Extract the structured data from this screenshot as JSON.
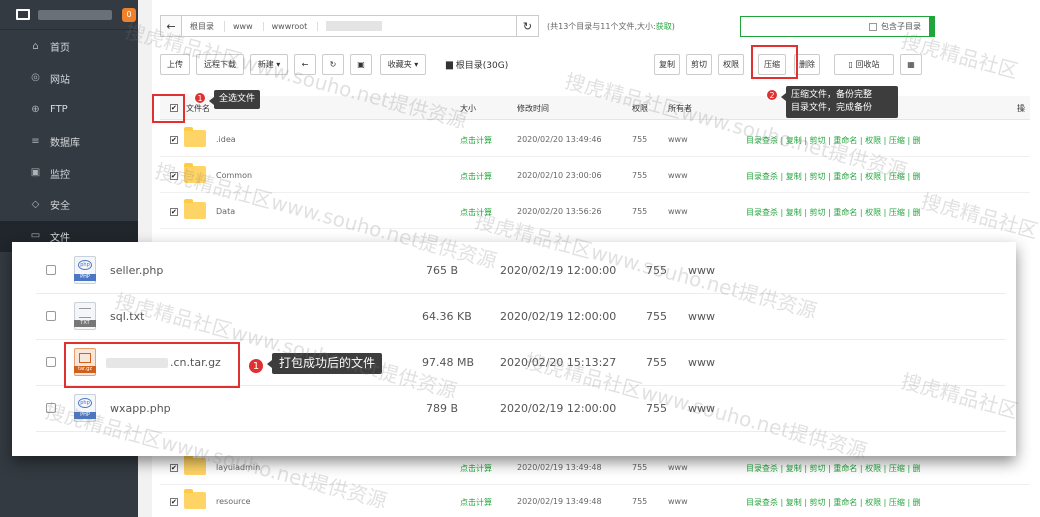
{
  "sidebar": {
    "badge": "0",
    "items": [
      {
        "label": "首页",
        "icon": "home-icon"
      },
      {
        "label": "网站",
        "icon": "globe-icon"
      },
      {
        "label": "FTP",
        "icon": "ftp-icon"
      },
      {
        "label": "数据库",
        "icon": "database-icon"
      },
      {
        "label": "监控",
        "icon": "monitor-icon"
      },
      {
        "label": "安全",
        "icon": "shield-icon"
      },
      {
        "label": "文件",
        "icon": "folder-icon"
      }
    ]
  },
  "pathbar": {
    "root": "根目录",
    "crumb1": "www",
    "crumb2": "wwwroot",
    "info_prefix": "(共13个目录与11个文件,大小:",
    "info_link": "获取",
    "info_suffix": ")",
    "subdir_label": "包含子目录"
  },
  "toolbar": {
    "upload": "上传",
    "remote_download": "远程下载",
    "new": "新建",
    "favorites": "收藏夹",
    "disk": "根目录(30G)",
    "copy": "复制",
    "cut": "剪切",
    "perm": "权限",
    "compress": "压缩",
    "delete": "删除",
    "recycle": "回收站"
  },
  "table": {
    "headers": {
      "name": "文件名",
      "size": "大小",
      "mtime": "修改时间",
      "perm": "权限",
      "owner": "所有者",
      "op": "操"
    },
    "rows": [
      {
        "name": ".idea",
        "size": "点击计算",
        "mtime": "2020/02/20 13:49:46",
        "perm": "755",
        "owner": "www"
      },
      {
        "name": "Common",
        "size": "点击计算",
        "mtime": "2020/02/10 23:00:06",
        "perm": "755",
        "owner": "www"
      },
      {
        "name": "Data",
        "size": "点击计算",
        "mtime": "2020/02/20 13:56:26",
        "perm": "755",
        "owner": "www"
      }
    ],
    "bottom_rows": [
      {
        "name": "layuiadmin",
        "size": "点击计算",
        "mtime": "2020/02/19 13:49:48",
        "perm": "755",
        "owner": "www"
      },
      {
        "name": "resource",
        "size": "点击计算",
        "mtime": "2020/02/19 13:49:48",
        "perm": "755",
        "owner": "www"
      }
    ],
    "ops": "目录查杀 | 复制 | 剪切 | 重命名 | 权限 | 压缩 | 删"
  },
  "callouts": {
    "select_all": "全选文件",
    "compress_tip_line1": "压缩文件，备份完整",
    "compress_tip_line2": "目录文件，完成备份",
    "packed_tip": "打包成功后的文件",
    "n1": "1",
    "n2": "2"
  },
  "zoom": {
    "rows": [
      {
        "name": "seller.php",
        "size": "765 B",
        "mtime": "2020/02/19 12:00:00",
        "perm": "755",
        "owner": "www",
        "type": "PHP"
      },
      {
        "name": "sql.txt",
        "size": "64.36 KB",
        "mtime": "2020/02/19 12:00:00",
        "perm": "755",
        "owner": "www",
        "type": "TXT"
      },
      {
        "name": ".cn.tar.gz",
        "size": "97.48 MB",
        "mtime": "2020/02/20 15:13:27",
        "perm": "755",
        "owner": "www",
        "type": "tar.gz"
      },
      {
        "name": "wxapp.php",
        "size": "789 B",
        "mtime": "2020/02/19 12:00:00",
        "perm": "755",
        "owner": "www",
        "type": "PHP"
      }
    ]
  },
  "watermark": "搜虎精品社区www.souho.net提供资源",
  "watermark_short": "搜虎精品社区"
}
